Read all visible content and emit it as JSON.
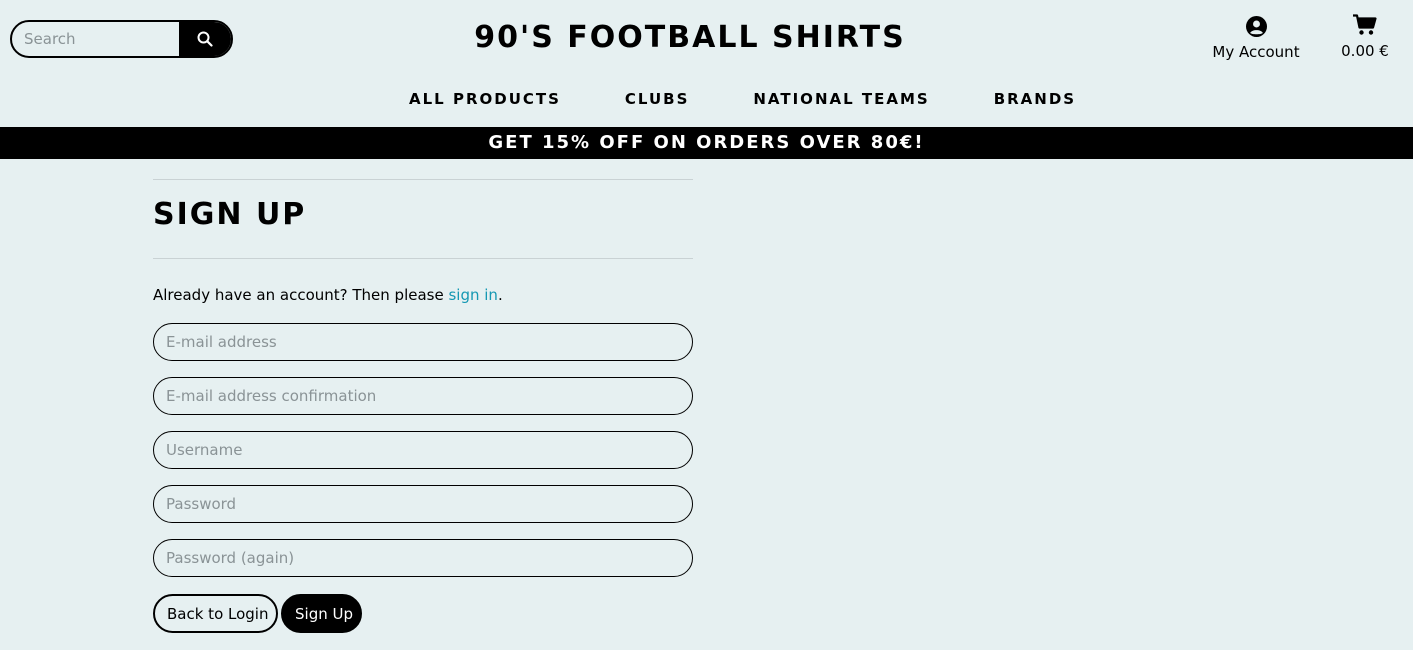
{
  "header": {
    "search": {
      "placeholder": "Search"
    },
    "site_title": "90'S FOOTBALL SHIRTS",
    "account_label": "My Account",
    "cart_total": "0.00 €"
  },
  "nav": {
    "items": [
      {
        "label": "ALL PRODUCTS"
      },
      {
        "label": "CLUBS"
      },
      {
        "label": "NATIONAL TEAMS"
      },
      {
        "label": "BRANDS"
      }
    ]
  },
  "promo": {
    "text": "GET 15% OFF ON ORDERS OVER 80€!"
  },
  "signup": {
    "title": "SIGN UP",
    "already_prefix": "Already have an account? Then please ",
    "sign_in_link": "sign in",
    "already_suffix": ".",
    "fields": [
      {
        "placeholder": "E-mail address"
      },
      {
        "placeholder": "E-mail address confirmation"
      },
      {
        "placeholder": "Username"
      },
      {
        "placeholder": "Password"
      },
      {
        "placeholder": "Password (again)"
      }
    ],
    "back_button": "Back to Login",
    "submit_button": "Sign Up"
  },
  "colors": {
    "background": "#e6f0f1",
    "link": "#1598b3",
    "banner": "#000000"
  },
  "icons": {
    "search": "search-icon",
    "account": "user-circle-icon",
    "cart": "cart-icon"
  }
}
